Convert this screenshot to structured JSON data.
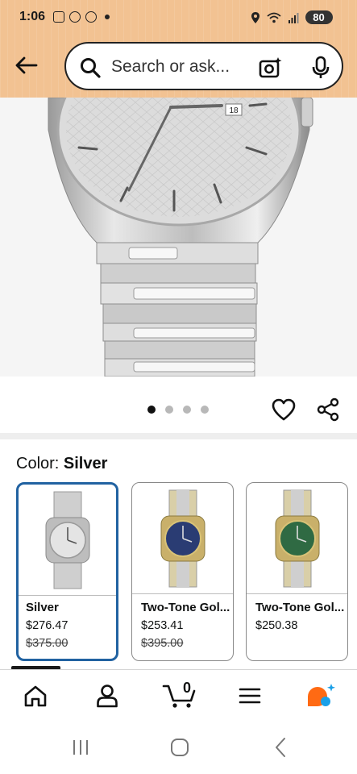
{
  "status_bar": {
    "time": "1:06",
    "battery": "80"
  },
  "search": {
    "placeholder": "Search or ask..."
  },
  "product": {
    "image_alt": "Silver Bulova watch close-up",
    "carousel": {
      "pages": 4,
      "active_index": 0
    }
  },
  "color_section": {
    "label": "Color: ",
    "selected_value": "Silver"
  },
  "variants": [
    {
      "name": "Silver",
      "price": "$276.47",
      "list_price": "$375.00",
      "dial_color": "#e4e4e4",
      "selected": true
    },
    {
      "name": "Two-Tone Gol...",
      "price": "$253.41",
      "list_price": "$395.00",
      "dial_color": "#2a3c73",
      "selected": false
    },
    {
      "name": "Two-Tone Gol...",
      "price": "$250.38",
      "list_price": "",
      "dial_color": "#2f6a43",
      "selected": false
    }
  ],
  "bottom_nav": {
    "cart_count": "0",
    "items": [
      "home-icon",
      "account-icon",
      "cart-icon",
      "menu-icon",
      "rufus-icon"
    ]
  },
  "colors": {
    "header_bg": "#f2c292",
    "selected_border": "#2162a1",
    "rufus_orange": "#ff6a13",
    "rufus_blue": "#1aa0e8"
  }
}
